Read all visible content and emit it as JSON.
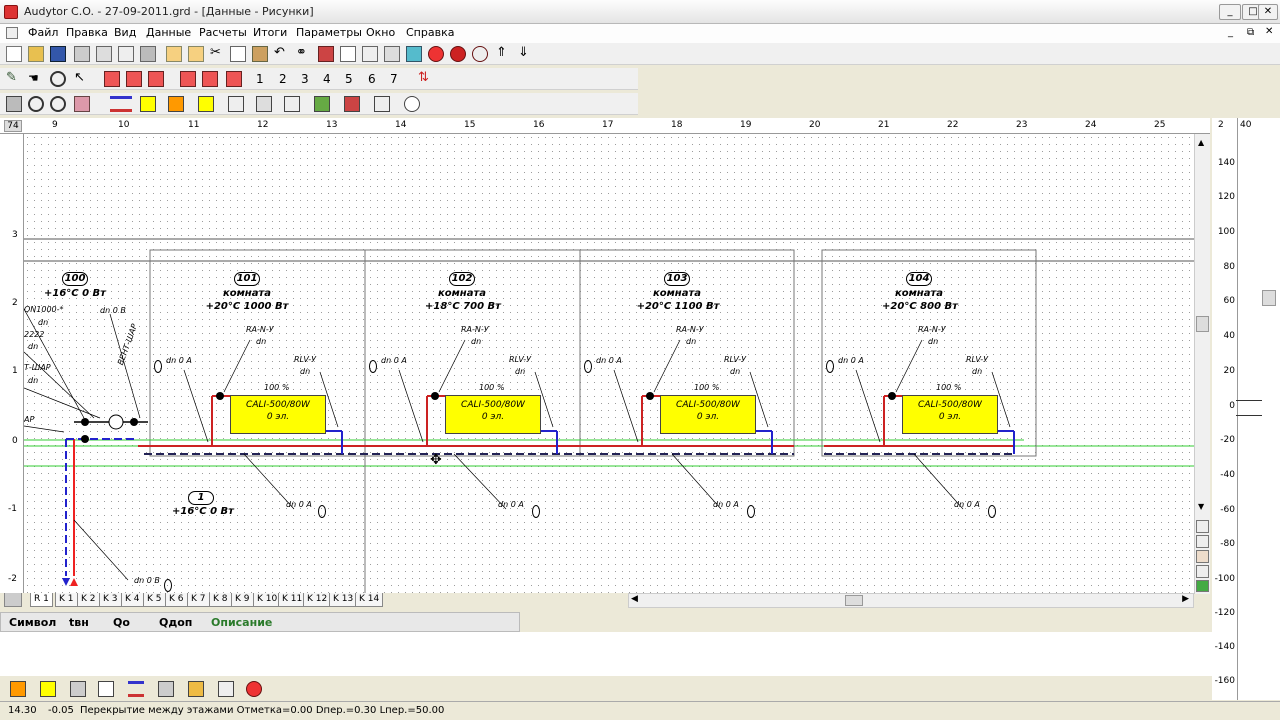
{
  "window": {
    "title": "Audytor C.O.  - 27-09-2011.grd - [Данные - Рисунки]"
  },
  "menu": [
    "Файл",
    "Правка",
    "Вид",
    "Данные",
    "Расчеты",
    "Итоги",
    "Параметры",
    "Окно",
    "Справка"
  ],
  "toolbar": {
    "numbers": [
      "1",
      "2",
      "3",
      "4",
      "5",
      "6",
      "7"
    ]
  },
  "ruler": {
    "corner": "74",
    "top": [
      "9",
      "10",
      "11",
      "12",
      "13",
      "14",
      "15",
      "16",
      "17",
      "18",
      "19",
      "20",
      "21",
      "22",
      "23",
      "24",
      "25"
    ],
    "left": [
      "3",
      "2",
      "1",
      "0",
      "-1",
      "-2"
    ]
  },
  "rooms": [
    {
      "num": "101",
      "name": "комната",
      "info": "+20°C 1000 Вт",
      "ra": "RA-N-У",
      "dn": "dn",
      "rlv": "RLV-У",
      "rlvdn": "dn",
      "pct": "100 %",
      "rad": "CALI-500/80W",
      "el": "0 эл.",
      "pipe": "dn 0 A",
      "pipe2": "dn 0 A"
    },
    {
      "num": "102",
      "name": "комната",
      "info": "+18°C 700 Вт",
      "ra": "RA-N-У",
      "dn": "dn",
      "rlv": "RLV-У",
      "rlvdn": "dn",
      "pct": "100 %",
      "rad": "CALI-500/80W",
      "el": "0 эл.",
      "pipe": "dn 0 A",
      "pipe2": "dn 0 A"
    },
    {
      "num": "103",
      "name": "комната",
      "info": "+20°C 1100 Вт",
      "ra": "RA-N-У",
      "dn": "dn",
      "rlv": "RLV-У",
      "rlvdn": "dn",
      "pct": "100 %",
      "rad": "CALI-500/80W",
      "el": "0 эл.",
      "pipe": "dn 0 A",
      "pipe2": "dn 0 A"
    },
    {
      "num": "104",
      "name": "комната",
      "info": "+20°C 800 Вт",
      "ra": "RA-N-У",
      "dn": "dn",
      "rlv": "RLV-У",
      "rlvdn": "dn",
      "pct": "100 %",
      "rad": "CALI-500/80W",
      "el": "0 эл.",
      "pipe": "dn 0 A",
      "pipe2": "dn 0 A"
    }
  ],
  "left_node": {
    "num": "100",
    "info": "+16°C 0 Вт",
    "labels": [
      "ON1000-*",
      "dn",
      "2222",
      "dn",
      "Т-ШАР",
      "dn",
      "АР"
    ],
    "dnob": "dn 0 В",
    "vert": "ВЕНТ-ШАР"
  },
  "lower_node": {
    "num": "1",
    "info": "+16°C 0 Вт",
    "dn": "dn 0 A",
    "dn2": "dn 0 В"
  },
  "sheet_tabs": [
    "R 1",
    "K 1",
    "K 2",
    "K 3",
    "K 4",
    "K 5",
    "K 6",
    "K 7",
    "K 8",
    "K 9",
    "K 10",
    "K 11",
    "K 12",
    "K 13",
    "K 14"
  ],
  "table": {
    "headers": [
      "Символ",
      "tвн",
      "Qo",
      "Qдоп",
      "Описание"
    ]
  },
  "status": {
    "x": "14.30",
    "y": "-0.05",
    "text": "Перекрытие между этажами  Отметка=0.00  Dпер.=0.30  Lпер.=50.00"
  },
  "side": {
    "top": "2",
    "scale_top": "40",
    "scale": [
      "140",
      "120",
      "100",
      "80",
      "60",
      "40",
      "20",
      "0",
      "-20",
      "-40",
      "-60",
      "-80",
      "-100",
      "-120",
      "-140",
      "-160"
    ]
  }
}
